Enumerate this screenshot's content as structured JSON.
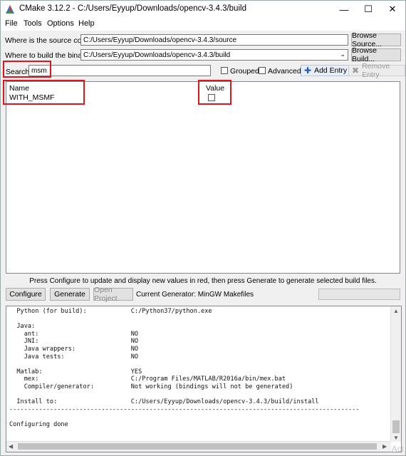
{
  "window": {
    "title": "CMake 3.12.2 - C:/Users/Eyyup/Downloads/opencv-3.4.3/build"
  },
  "menu": [
    "File",
    "Tools",
    "Options",
    "Help"
  ],
  "source": {
    "label": "Where is the source code:",
    "value": "C:/Users/Eyyup/Downloads/opencv-3.4.3/source",
    "button": "Browse Source..."
  },
  "build": {
    "label": "Where to build the binaries:",
    "value": "C:/Users/Eyyup/Downloads/opencv-3.4.3/build",
    "button": "Browse Build..."
  },
  "search": {
    "label": "Search:",
    "value": "msm"
  },
  "options": {
    "grouped": "Grouped",
    "advanced": "Advanced",
    "add_entry": "Add Entry",
    "remove_entry": "Remove Entry"
  },
  "table": {
    "col_name": "Name",
    "col_value": "Value",
    "rows": [
      {
        "name": "WITH_MSMF",
        "checked": false
      }
    ]
  },
  "status": "Press Configure to update and display new values in red, then press Generate to generate selected build files.",
  "actions": {
    "configure": "Configure",
    "generate": "Generate",
    "open_project": "Open Project",
    "current_generator": "Current Generator: MinGW Makefiles"
  },
  "log_text": "  Python (for build):            C:/Python37/python.exe\n\n  Java:\n    ant:                         NO\n    JNI:                         NO\n    Java wrappers:               NO\n    Java tests:                  NO\n\n  Matlab:                        YES\n    mex:                         C:/Program Files/MATLAB/R2016a/bin/mex.bat\n    Compiler/generator:          Not working (bindings will not be generated)\n\n  Install to:                    C:/Users/Eyyup/Downloads/opencv-3.4.3/build/install\n-----------------------------------------------------------------------------------------------\n\nConfiguring done",
  "watermark": "Act",
  "icons": {
    "app": "cmake-triangle-icon",
    "add": "plus-icon",
    "remove": "minus-icon"
  },
  "colors": {
    "highlight_box": "#e0141c",
    "add_icon": "#1f5fbf"
  }
}
